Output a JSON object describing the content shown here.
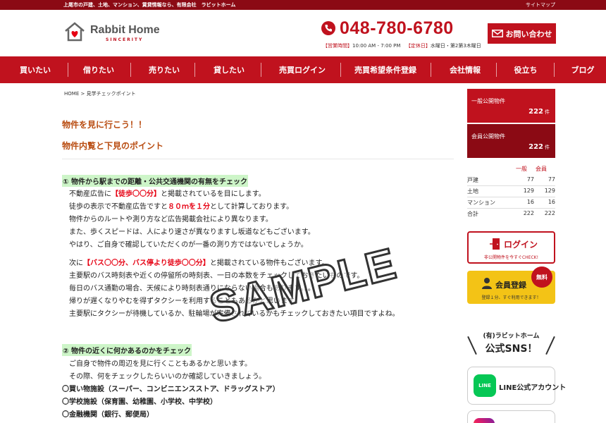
{
  "topbar": {
    "tagline": "上尾市の戸建、土地、マンション、賃貸情報なら、有限会社　ラビットホーム",
    "sitemap": "サイトマップ"
  },
  "header": {
    "logo_name": "Rabbit Home",
    "logo_sub": "SINCERITY",
    "phone": "048-780-6780",
    "hours_label1": "【営業時間】",
    "hours_value1": "10:00 AM - 7:00 PM",
    "hours_label2": "【定休日】",
    "hours_value2": "水曜日・第2第3木曜日",
    "contact": "お問い合わせ"
  },
  "nav": [
    {
      "label": "買いたい"
    },
    {
      "label": "借りたい"
    },
    {
      "label": "売りたい"
    },
    {
      "label": "貸したい"
    },
    {
      "label": "売買ログイン"
    },
    {
      "label": "売買希望条件登録"
    },
    {
      "label": "会社情報"
    },
    {
      "label": "役立ち"
    },
    {
      "label": "ブログ"
    }
  ],
  "breadcrumb": {
    "home": "HOME",
    "sep": " > ",
    "current": "見学チェックポイント"
  },
  "main": {
    "heading1": "物件を見に行こう！！",
    "heading2": "物件内覧と下見のポイント",
    "section1": {
      "title": "① 物件から駅までの距離・公共交通機関の有無をチェック",
      "p1_a": "不動産広告に",
      "p1_red": "【徒歩〇〇分】",
      "p1_b": "と掲載されているを目にします。",
      "p2_a": "徒歩の表示で不動産広告ですと",
      "p2_red": "８０ｍを１分",
      "p2_b": "として計算しております。",
      "p3": "物件からのルートや測り方など広告掲載会社により異なります。",
      "p4": "また、歩くスピードは、人により速さが異なりますし坂道などもございます。",
      "p5": "やはり、ご自身で確認していただくのが一番の測り方ではないでしょうか。",
      "p6_a": "次に",
      "p6_red": "【バス〇〇分、バス停より徒歩〇〇分】",
      "p6_b": "と掲載されている物件もございます。",
      "p7": "主要駅のバス時刻表や近くの停留所の時刻表、一日の本数をチェックしておきたいものです。",
      "p8": "毎日のバス通勤の場合、天候により時刻表通りにならない場合もあります。。。",
      "p9": "帰りが遅くなりやむを得ずタクシーを利用することもあるかと思います。",
      "p10": "主要駅にタクシーが待機しているか、駐輪場が完備されているかもチェックしておきたい項目ですよね。"
    },
    "section2": {
      "title": "② 物件の近くに何かあるのかをチェック",
      "p1": "ご自身で物件の周辺を見に行くこともあるかと思います。",
      "p2": "その際、何をチェックしたらいいのか確認していきましょう。",
      "b1": "〇買い物施設（スーパー、コンビニエンスストア、ドラッグストア）",
      "b2": "〇学校施設（保育園、幼稚園、小学校、中学校）",
      "b3": "〇金融機関（銀行、郵便局）"
    },
    "watermark": "SAMPLE"
  },
  "sidebar": {
    "public": {
      "label": "一般公開物件",
      "count": "222",
      "unit": "件"
    },
    "member": {
      "label": "会員公開物件",
      "count": "222",
      "unit": "件"
    },
    "stats_header": {
      "a": "一般",
      "b": "会員"
    },
    "stats": [
      {
        "name": "戸建",
        "a": "77",
        "b": "77"
      },
      {
        "name": "土地",
        "a": "129",
        "b": "129"
      },
      {
        "name": "マンション",
        "a": "16",
        "b": "16"
      },
      {
        "name": "合計",
        "a": "222",
        "b": "222"
      }
    ],
    "login": {
      "label": "ログイン",
      "sub": "非公開物件を今すぐCHECK!"
    },
    "register": {
      "label": "会員登録",
      "sub": "登録１分、すぐ利用できます！",
      "badge": "無料"
    },
    "sns": {
      "line1": "(有)ラビットホーム",
      "line2": "公式SNS！"
    },
    "line_btn": {
      "icon": "LINE",
      "label": "LINE公式アカウント"
    }
  },
  "colors": {
    "brand_red": "#c0121e",
    "dark_red": "#8b0a14",
    "heading_orange": "#b94d12",
    "highlight_green": "#cdf5c8",
    "register_yellow": "#f3c316"
  }
}
